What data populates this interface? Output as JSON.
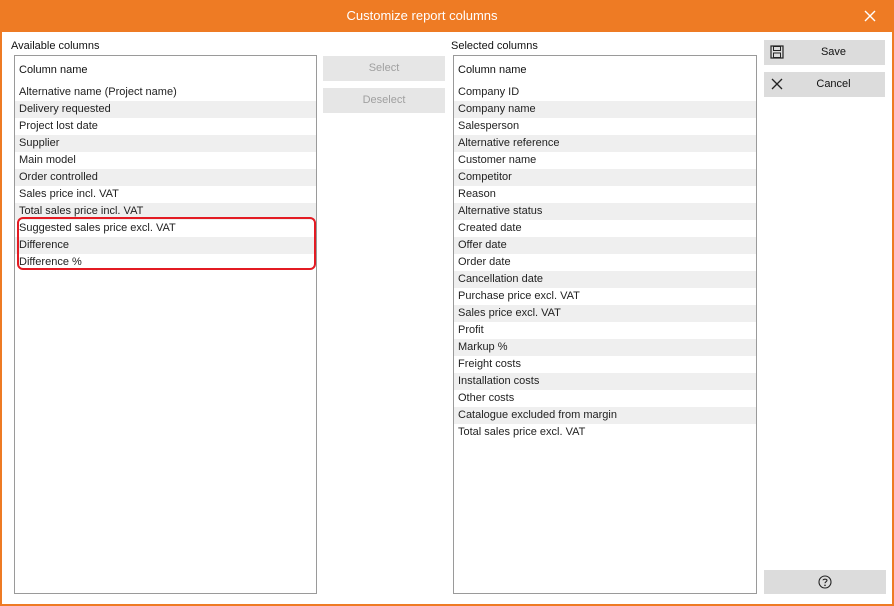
{
  "window": {
    "title": "Customize report columns",
    "close_icon": "close-icon",
    "accent_color": "#ee7b24"
  },
  "available": {
    "section_label": "Available columns",
    "column_header": "Column name",
    "items": [
      "Alternative name (Project name)",
      "Delivery requested",
      "Project lost date",
      "Supplier",
      "Main model",
      "Order controlled",
      "Sales price incl. VAT",
      "Total sales price incl. VAT",
      "Suggested sales price excl. VAT",
      "Difference",
      "Difference %"
    ],
    "highlight_color": "#e31b23"
  },
  "actions": {
    "select_label": "Select",
    "deselect_label": "Deselect"
  },
  "selected": {
    "section_label": "Selected columns",
    "column_header": "Column name",
    "items": [
      "Company ID",
      "Company name",
      "Salesperson",
      "Alternative reference",
      "Customer name",
      "Competitor",
      "Reason",
      "Alternative status",
      "Created date",
      "Offer date",
      "Order date",
      "Cancellation date",
      "Purchase price excl. VAT",
      "Sales price excl. VAT",
      "Profit",
      "Markup %",
      "Freight costs",
      "Installation costs",
      "Other costs",
      "Catalogue excluded from margin",
      "Total sales price excl. VAT"
    ]
  },
  "side": {
    "save_label": "Save",
    "save_icon": "floppy-disk-icon",
    "cancel_label": "Cancel",
    "cancel_icon": "close-icon",
    "help_icon": "help-icon"
  }
}
